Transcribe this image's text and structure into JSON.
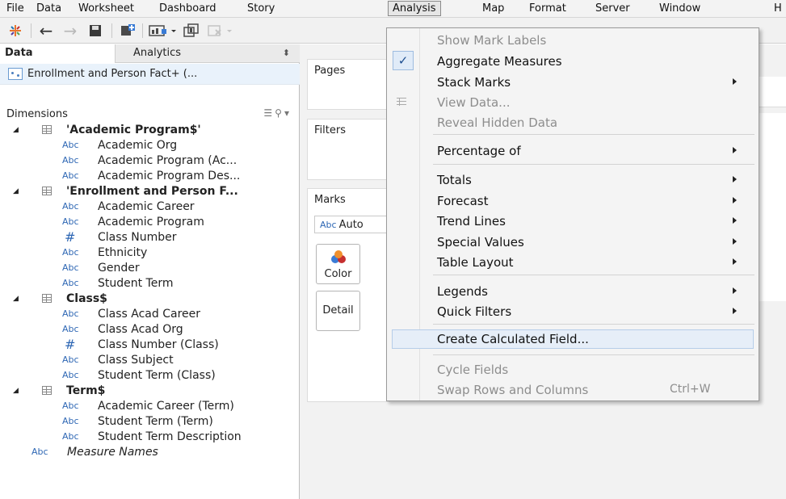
{
  "menubar": {
    "items": [
      "File",
      "Data",
      "Worksheet",
      "Dashboard",
      "Story",
      "Analysis",
      "Map",
      "Format",
      "Server",
      "Window",
      "H"
    ],
    "active": "Analysis"
  },
  "toolbar": {
    "icons": [
      "tableau-logo-icon",
      "back-icon",
      "forward-icon",
      "save-icon",
      "new-datasource-icon",
      "new-worksheet-icon",
      "duplicate-icon",
      "clear-icon"
    ]
  },
  "data_pane": {
    "tabs": {
      "data": "Data",
      "analytics": "Analytics"
    },
    "datasource": "Enrollment and Person Fact+ (...",
    "dimensions_label": "Dimensions",
    "groups": [
      {
        "name": "'Academic Program$'",
        "fields": [
          {
            "type": "Abc",
            "label": "Academic Org"
          },
          {
            "type": "Abc",
            "label": "Academic Program (Ac..."
          },
          {
            "type": "Abc",
            "label": "Academic Program Des..."
          }
        ]
      },
      {
        "name": "'Enrollment and Person F...",
        "fields": [
          {
            "type": "Abc",
            "label": "Academic Career"
          },
          {
            "type": "Abc",
            "label": "Academic Program"
          },
          {
            "type": "#",
            "label": "Class Number"
          },
          {
            "type": "Abc",
            "label": "Ethnicity"
          },
          {
            "type": "Abc",
            "label": "Gender"
          },
          {
            "type": "Abc",
            "label": "Student Term"
          }
        ]
      },
      {
        "name": "Class$",
        "fields": [
          {
            "type": "Abc",
            "label": "Class Acad Career"
          },
          {
            "type": "Abc",
            "label": "Class Acad Org"
          },
          {
            "type": "#",
            "label": "Class Number (Class)"
          },
          {
            "type": "Abc",
            "label": "Class Subject"
          },
          {
            "type": "Abc",
            "label": "Student Term (Class)"
          }
        ]
      },
      {
        "name": "Term$",
        "fields": [
          {
            "type": "Abc",
            "label": "Academic Career (Term)"
          },
          {
            "type": "Abc",
            "label": "Student Term (Term)"
          },
          {
            "type": "Abc",
            "label": "Student Term Description"
          }
        ]
      }
    ],
    "measure_names": {
      "type": "Abc",
      "label": "Measure Names"
    }
  },
  "cards": {
    "pages": "Pages",
    "filters": "Filters",
    "marks": "Marks",
    "mark_type_abc": "Abc",
    "mark_type": "Auto",
    "color": "Color",
    "detail": "Detail"
  },
  "analysis_menu": {
    "items": [
      {
        "label": "Show Mark Labels",
        "disabled": true
      },
      {
        "label": "Aggregate Measures",
        "checked": true
      },
      {
        "label": "Stack Marks",
        "submenu": true
      },
      {
        "label": "View Data...",
        "disabled": true,
        "icon": "view-data-icon"
      },
      {
        "label": "Reveal Hidden Data",
        "disabled": true
      },
      {
        "label": "Percentage of",
        "submenu": true
      },
      {
        "label": "Totals",
        "submenu": true
      },
      {
        "label": "Forecast",
        "submenu": true
      },
      {
        "label": "Trend Lines",
        "submenu": true
      },
      {
        "label": "Special Values",
        "submenu": true
      },
      {
        "label": "Table Layout",
        "submenu": true
      },
      {
        "label": "Legends",
        "submenu": true
      },
      {
        "label": "Quick Filters",
        "submenu": true
      },
      {
        "label": "Create Calculated Field...",
        "highlighted": true
      },
      {
        "label": "Cycle Fields",
        "disabled": true
      },
      {
        "label": "Swap Rows and Columns",
        "disabled": true,
        "shortcut": "Ctrl+W"
      }
    ],
    "check_glyph": "✓"
  },
  "colors": {
    "menu_bg": "#f4f4f4",
    "highlight": "#e6eef8",
    "field_type": "#2e67b4",
    "disabled_text": "#8d8d8d"
  }
}
